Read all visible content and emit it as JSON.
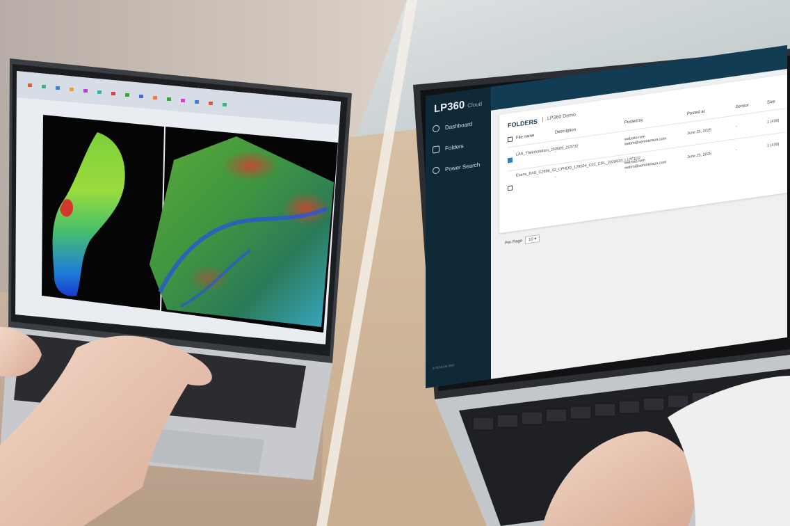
{
  "right_app": {
    "logo": "LP360",
    "logo_sub": "Cloud",
    "nav": [
      {
        "label": "Dashboard",
        "icon": "speedometer-icon"
      },
      {
        "label": "Folders",
        "icon": "folder-icon"
      },
      {
        "label": "Power Search",
        "icon": "search-person-icon"
      }
    ],
    "breadcrumb_title": "FOLDERS",
    "breadcrumb_sub": "LP360 Demo",
    "columns": [
      "File name",
      "Description",
      "Posted by",
      "Posted at",
      "Sensor",
      "Size"
    ],
    "rows": [
      {
        "checked": true,
        "file": "LAS_Theinfodation_250509_213732",
        "description": "-",
        "posted_by": "website rem\nwebm@semntinaza.com",
        "posted_at": "June 25, 2025",
        "sensor": "-",
        "size": "1 (439)"
      },
      {
        "checked": false,
        "file": "Evans_EAS_C2698_02_CFHDD_129504_C01_CRL_2028633_L17F1D2",
        "description": "-",
        "posted_by": "website rem\nwebm@semntinaza.com",
        "posted_at": "June 25, 2025",
        "sensor": "-",
        "size": "1 (439)"
      }
    ],
    "per_page_label": "Per Page",
    "per_page_value": "10",
    "footer": "© GEOCUE 2025"
  },
  "colors": {
    "sidebar": "#0f2a36",
    "topbar": "#123c54",
    "accent": "#2f7fc4"
  }
}
